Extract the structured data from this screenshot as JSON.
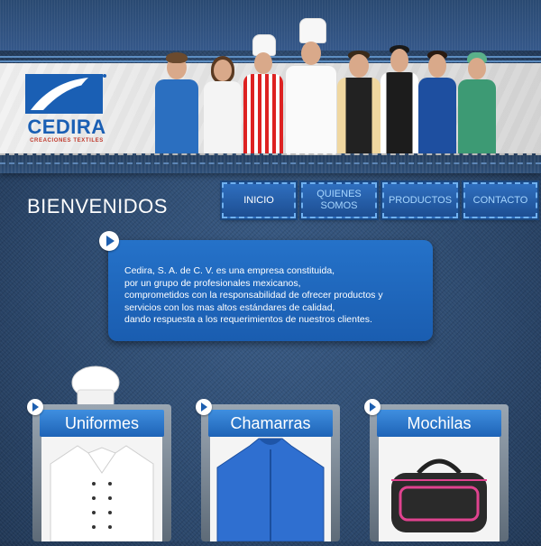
{
  "brand": {
    "name": "CEDIRA",
    "tagline": "CREACIONES TEXTILES",
    "colors": {
      "primary": "#1a5fb4",
      "accent": "#c0392b"
    }
  },
  "page": {
    "title": "BIENVENIDOS"
  },
  "nav": {
    "items": [
      {
        "label": "INICIO",
        "active": true
      },
      {
        "label": "QUIENES\nSOMOS",
        "active": false
      },
      {
        "label": "PRODUCTOS",
        "active": false
      },
      {
        "label": "CONTACTO",
        "active": false
      }
    ]
  },
  "intro": {
    "lines": [
      "Cedira, S. A. de C. V. es una empresa constituida,",
      "por un grupo de profesionales mexicanos,",
      "comprometidos con la responsabilidad de ofrecer productos y",
      "servicios con los mas altos estándares de calidad,",
      "dando respuesta a los requerimientos de nuestros clientes."
    ]
  },
  "products": [
    {
      "label": "Uniformes",
      "image": "chef-jacket-image"
    },
    {
      "label": "Chamarras",
      "image": "blue-jacket-image"
    },
    {
      "label": "Mochilas",
      "image": "duffel-bag-image"
    }
  ]
}
